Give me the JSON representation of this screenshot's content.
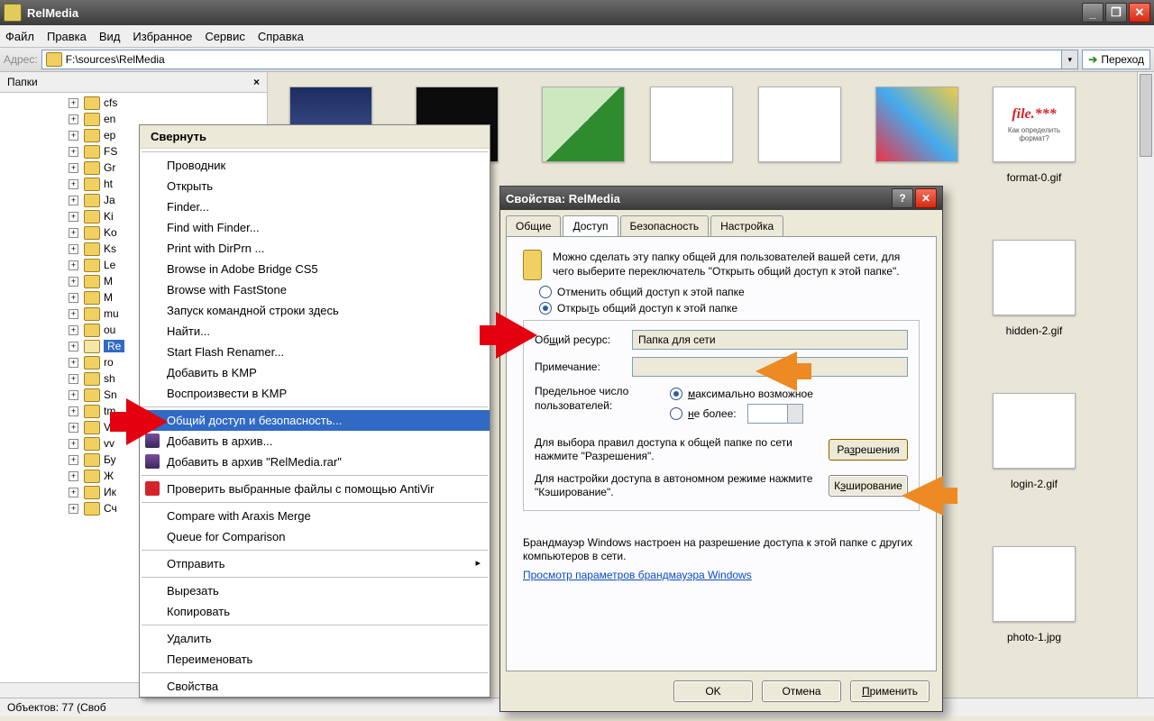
{
  "titlebar": {
    "title": "RelMedia"
  },
  "menubar": {
    "items": [
      "Файл",
      "Правка",
      "Вид",
      "Избранное",
      "Сервис",
      "Справка"
    ]
  },
  "address": {
    "label": "Адрес:",
    "path": "F:\\sources\\RelMedia",
    "go": "Переход"
  },
  "side": {
    "header": "Папки",
    "nodes": [
      "cfs",
      "en",
      "ep",
      "FS",
      "Gr",
      "ht",
      "Ja",
      "Ki",
      "Ko",
      "Ks",
      "Le",
      "M",
      "M",
      "mu",
      "ou",
      "Re",
      "ro",
      "sh",
      "Sn",
      "tm",
      "Va",
      "vv",
      "Бу",
      "Ж",
      "Ик",
      "Сч"
    ]
  },
  "thumbs": {
    "items": [
      "format-0.gif",
      "hidden-2.gif",
      "login-2.gif",
      "photo-1.jpg"
    ]
  },
  "status": {
    "text": "Объектов: 77 (Своб"
  },
  "ctx": {
    "collapse": "Свернуть",
    "g1": [
      "Проводник",
      "Открыть",
      "Finder...",
      "Find with Finder...",
      "Print with DirPrn ...",
      "Browse in Adobe Bridge CS5",
      "Browse with FastStone",
      "Запуск командной строки здесь",
      "Найти...",
      "Start Flash Renamer...",
      "Добавить в KMP",
      "Воспроизвести в KMP"
    ],
    "share": "Общий доступ и безопасность...",
    "g2": [
      "Добавить в архив...",
      "Добавить в архив \"RelMedia.rar\""
    ],
    "antivir": "Проверить выбранные файлы с помощью AntiVir",
    "g3": [
      "Compare with Araxis Merge",
      "Queue for Comparison"
    ],
    "send": "Отправить",
    "g4": [
      "Вырезать",
      "Копировать"
    ],
    "g5": [
      "Удалить",
      "Переименовать"
    ],
    "props": "Свойства"
  },
  "dlg": {
    "title": "Свойства: RelMedia",
    "tabs": [
      "Общие",
      "Доступ",
      "Безопасность",
      "Настройка"
    ],
    "intro": "Можно сделать эту папку общей для пользователей вашей сети, для чего выберите переключатель \"Открыть общий доступ к этой папке\".",
    "r_off": "Отменить общий доступ к этой папке",
    "r_on_pre": "Откры",
    "r_on_u": "т",
    "r_on_post": "ь общий доступ к этой папке",
    "res_lbl_pre": "Об",
    "res_lbl_u": "щ",
    "res_lbl_post": "ий ресурс:",
    "res_val": "Папка для сети",
    "note_lbl": "Примечание:",
    "limit_lbl": "Предельное число пользователей:",
    "lim_max_u": "м",
    "lim_max_post": "аксимально возможное",
    "lim_no_u": "н",
    "lim_no_post": "е более:",
    "perm_text": "Для выбора правил доступа к общей папке по сети нажмите \"Разрешения\".",
    "perm_btn_pre": "Ра",
    "perm_btn_u": "з",
    "perm_btn_post": "решения",
    "cache_text": "Для настройки доступа в автономном режиме нажмите \"Кэширование\".",
    "cache_btn_pre": "К",
    "cache_btn_u": "э",
    "cache_btn_post": "ширование",
    "fw": "Брандмауэр Windows настроен на разрешение доступа к этой папке с других компьютеров в сети.",
    "fw_link": "Просмотр параметров брандмауэра Windows",
    "ok": "OK",
    "cancel": "Отмена",
    "apply_pre": "",
    "apply_u": "П",
    "apply_post": "рименить"
  }
}
